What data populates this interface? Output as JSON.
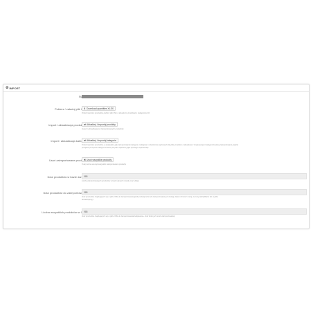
{
  "panel": {
    "title": "IMPORT"
  },
  "status": {
    "label": "Status"
  },
  "template": {
    "label": "Pobierz / załaduj plik XML",
    "button": "Download quantities XLSX",
    "help": "Przed importem produktów pobierz plik XML z aktualnymi produktami, kategoriami itd."
  },
  "import_products": {
    "label": "Import i aktualizacja produktów",
    "button": "Aktualizuj i importuj produkty",
    "help": "Import i aktualizacja już zaimportowanych produktów"
  },
  "import_categories": {
    "label": "Import i aktualizacja kategorii",
    "button": "Aktualizuj i importuj kategorie",
    "help1": "Przed importem produktów, w przypadku gdy zaimportowanie kategorii, rodzajowe i rozszerzone wybranych dla pliku produktu z aktualnymi i zmapowanymi kategorii zostaną zaimportowane jedynie",
    "help2": "pomijane (z importu kategorii zostaną do pliku zapisane gdyż ręcznego mapowania)"
  },
  "delete_products": {
    "label": "Usuń zaimportowane produkty",
    "button": "Usuń wszystkie produkty",
    "help": "Tutaj można usunąć wszystkie zaimportowane produkty"
  },
  "db_count": {
    "label": "Ilość produktów w bazie danych",
    "value": "985",
    "help": "Liczba zaimportowanych produktów w bazie danych modułu oraz sklepu"
  },
  "to_import": {
    "label": "Ilość produktów do zaimportowania",
    "value": "985",
    "help1": "Ilość produktów znajdujących się w pliku XML do zaimportowania (jeśli produkty które do zaimportowania już zostały, zatem ich ilość i cenę, numery identyfikator itd. w pliku",
    "help2": "aktualizujemy)"
  },
  "xml_total": {
    "label": "Liczba wszystkich produktów w XML",
    "value": "985",
    "help": "Ilość produktów znajdujących się w pliku XML do zaimportowania/nadpisania + ilość które już nie do zaimportowania)"
  },
  "colors": {
    "border": "#dcdcdc",
    "field_bg": "#eeeeee",
    "status_bar": "#8a8a8a"
  }
}
